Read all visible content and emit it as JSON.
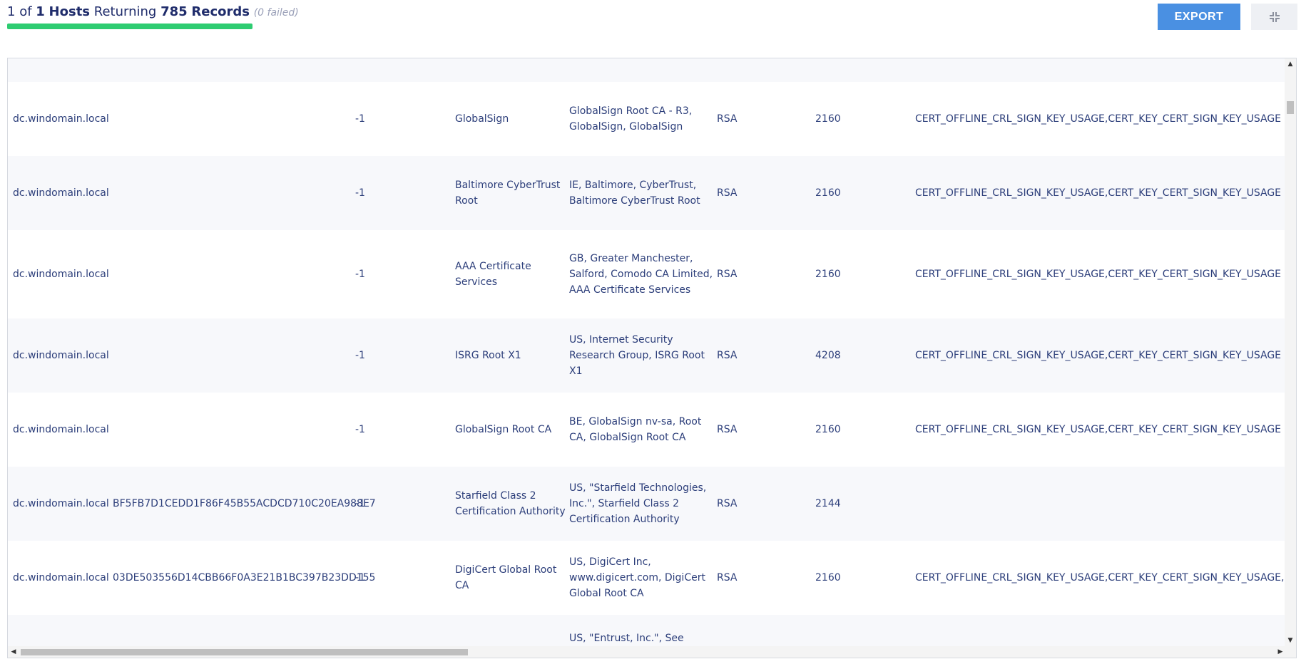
{
  "summary": {
    "hosts_done": "1",
    "of_label": "of",
    "hosts_total": "1",
    "hosts_label": "Hosts",
    "returning_label": "Returning",
    "records_count": "785",
    "records_label": "Records",
    "failed_text": "(0 failed)",
    "progress_fraction": 1.0,
    "progress_color": "#2ecc71"
  },
  "toolbar": {
    "export_label": "EXPORT",
    "collapse_icon": "collapse-icon"
  },
  "colors": {
    "accent": "#4a90e2",
    "text": "#2c3e7a",
    "row_alt": "#f7f8fb"
  },
  "rows": [
    {
      "hostname": "",
      "thumbprint": "",
      "col2": "",
      "issuer_cn": "",
      "subject": "",
      "algorithm": "",
      "key_length": "",
      "key_usage": ""
    },
    {
      "hostname": "dc.windomain.local",
      "thumbprint": "",
      "col2": "-1",
      "issuer_cn": "GlobalSign",
      "subject": "GlobalSign Root CA - R3, GlobalSign, GlobalSign",
      "algorithm": "RSA",
      "key_length": "2160",
      "key_usage": "CERT_OFFLINE_CRL_SIGN_KEY_USAGE,CERT_KEY_CERT_SIGN_KEY_USAGE"
    },
    {
      "hostname": "dc.windomain.local",
      "thumbprint": "",
      "col2": "-1",
      "issuer_cn": "Baltimore CyberTrust Root",
      "subject": "IE, Baltimore, CyberTrust, Baltimore CyberTrust Root",
      "algorithm": "RSA",
      "key_length": "2160",
      "key_usage": "CERT_OFFLINE_CRL_SIGN_KEY_USAGE,CERT_KEY_CERT_SIGN_KEY_USAGE"
    },
    {
      "hostname": "dc.windomain.local",
      "thumbprint": "",
      "col2": "-1",
      "issuer_cn": "AAA Certificate Services",
      "subject": "GB, Greater Manchester, Salford, Comodo CA Limited, AAA Certificate Services",
      "algorithm": "RSA",
      "key_length": "2160",
      "key_usage": "CERT_OFFLINE_CRL_SIGN_KEY_USAGE,CERT_KEY_CERT_SIGN_KEY_USAGE"
    },
    {
      "hostname": "dc.windomain.local",
      "thumbprint": "",
      "col2": "-1",
      "issuer_cn": "ISRG Root X1",
      "subject": "US, Internet Security Research Group, ISRG Root X1",
      "algorithm": "RSA",
      "key_length": "4208",
      "key_usage": "CERT_OFFLINE_CRL_SIGN_KEY_USAGE,CERT_KEY_CERT_SIGN_KEY_USAGE"
    },
    {
      "hostname": "dc.windomain.local",
      "thumbprint": "",
      "col2": "-1",
      "issuer_cn": "GlobalSign Root CA",
      "subject": "BE, GlobalSign nv-sa, Root CA, GlobalSign Root CA",
      "algorithm": "RSA",
      "key_length": "2160",
      "key_usage": "CERT_OFFLINE_CRL_SIGN_KEY_USAGE,CERT_KEY_CERT_SIGN_KEY_USAGE"
    },
    {
      "hostname": "dc.windomain.local",
      "thumbprint": "BF5FB7D1CEDD1F86F45B55ACDCD710C20EA988E7",
      "col2": "-1",
      "issuer_cn": "Starfield Class 2 Certification Authority",
      "subject": "US, \"Starfield Technologies, Inc.\", Starfield Class 2 Certification Authority",
      "algorithm": "RSA",
      "key_length": "2144",
      "key_usage": ""
    },
    {
      "hostname": "dc.windomain.local",
      "thumbprint": "03DE503556D14CBB66F0A3E21B1BC397B23DD155",
      "col2": "-1",
      "issuer_cn": "DigiCert Global Root CA",
      "subject": "US, DigiCert Inc, www.digicert.com, DigiCert Global Root CA",
      "algorithm": "RSA",
      "key_length": "2160",
      "key_usage": "CERT_OFFLINE_CRL_SIGN_KEY_USAGE,CERT_KEY_CERT_SIGN_KEY_USAGE,CERT_"
    },
    {
      "hostname": "",
      "thumbprint": "",
      "col2": "",
      "issuer_cn": "",
      "subject": "US, \"Entrust, Inc.\", See",
      "algorithm": "",
      "key_length": "",
      "key_usage": ""
    }
  ]
}
